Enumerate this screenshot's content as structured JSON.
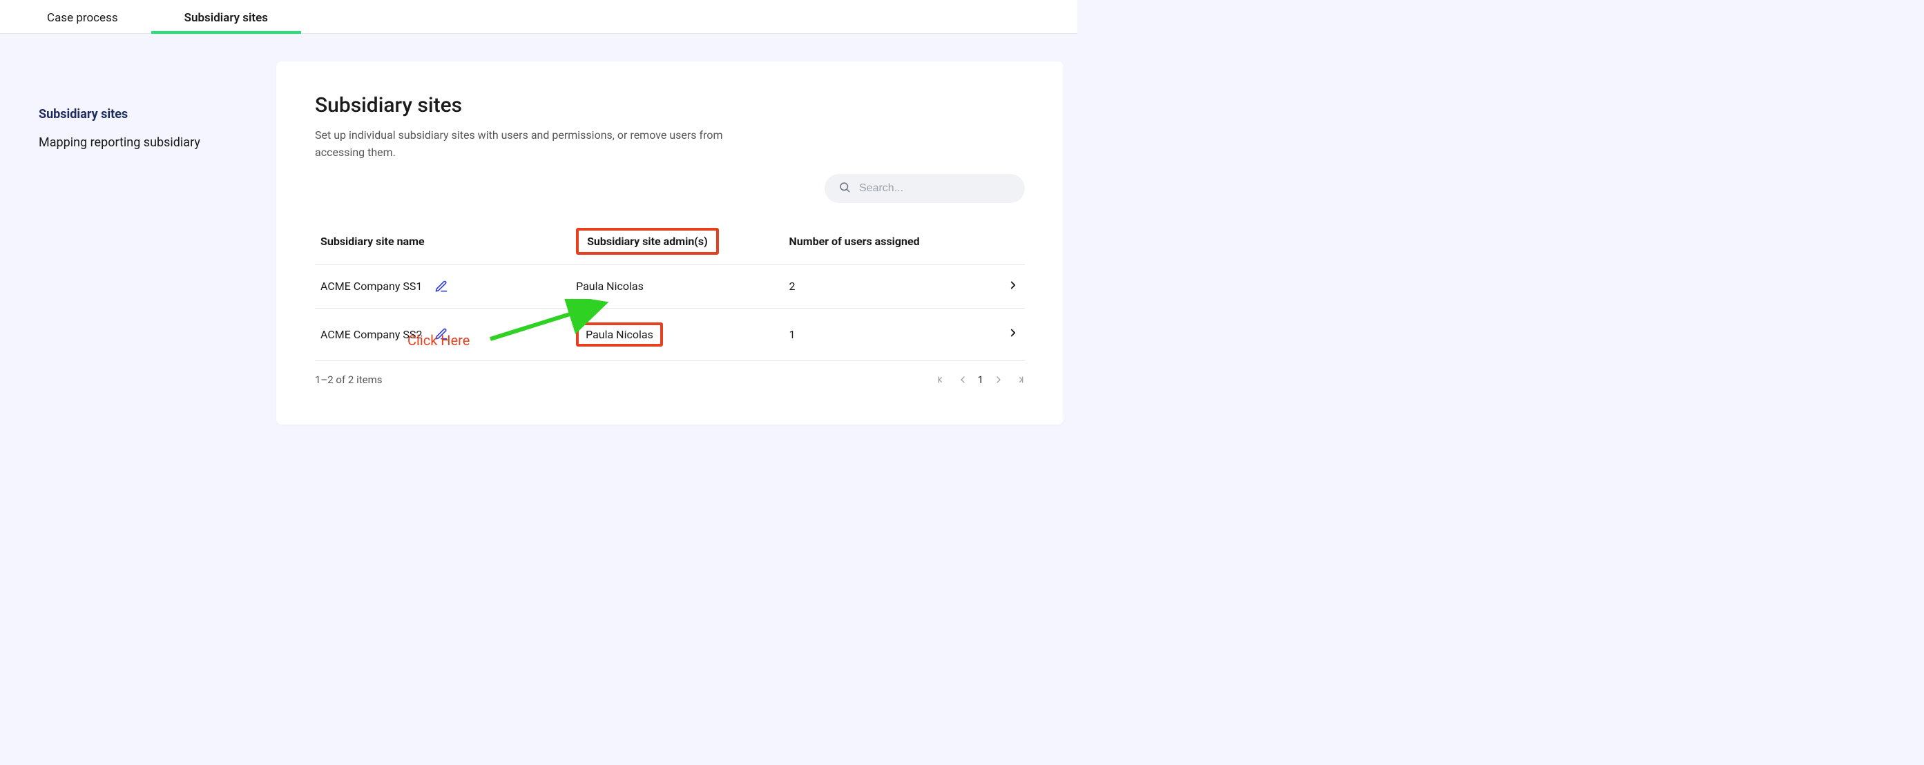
{
  "topTabs": {
    "items": [
      {
        "label": "Case process"
      },
      {
        "label": "Subsidiary sites"
      }
    ],
    "activeIndex": 1
  },
  "sidebar": {
    "items": [
      {
        "label": "Subsidiary sites"
      },
      {
        "label": "Mapping reporting subsidiary"
      }
    ],
    "activeIndex": 0
  },
  "main": {
    "title": "Subsidiary sites",
    "description": "Set up individual subsidiary sites with users and permissions, or remove users from accessing them.",
    "search": {
      "placeholder": "Search..."
    },
    "table": {
      "headers": {
        "name": "Subsidiary site name",
        "admin": "Subsidiary site admin(s)",
        "users": "Number of users assigned"
      },
      "rows": [
        {
          "name": "ACME Company SS1",
          "admin": "Paula Nicolas",
          "users": "2"
        },
        {
          "name": "ACME Company SS2",
          "admin": "Paula Nicolas",
          "users": "1"
        }
      ]
    },
    "pagination": {
      "summary": "1–2 of 2 items",
      "current": "1"
    }
  },
  "annotation": {
    "clickHere": "Click Here"
  }
}
